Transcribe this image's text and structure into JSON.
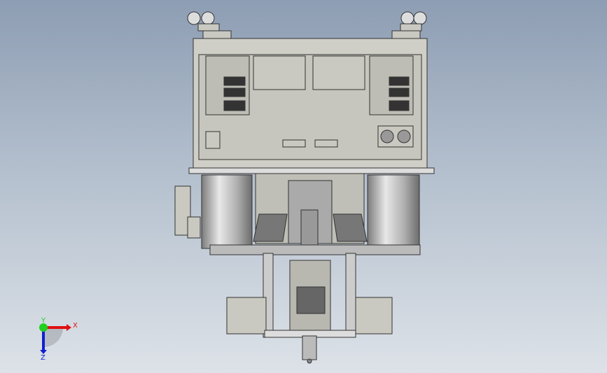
{
  "viewport": {
    "triad": {
      "x_label": "X",
      "y_label": "Y",
      "z_label": "Z"
    },
    "colors": {
      "x_axis": "#e01010",
      "y_axis": "#20d020",
      "z_axis": "#1020d0",
      "metal": "#c8c8c0",
      "edge": "#333333"
    }
  }
}
